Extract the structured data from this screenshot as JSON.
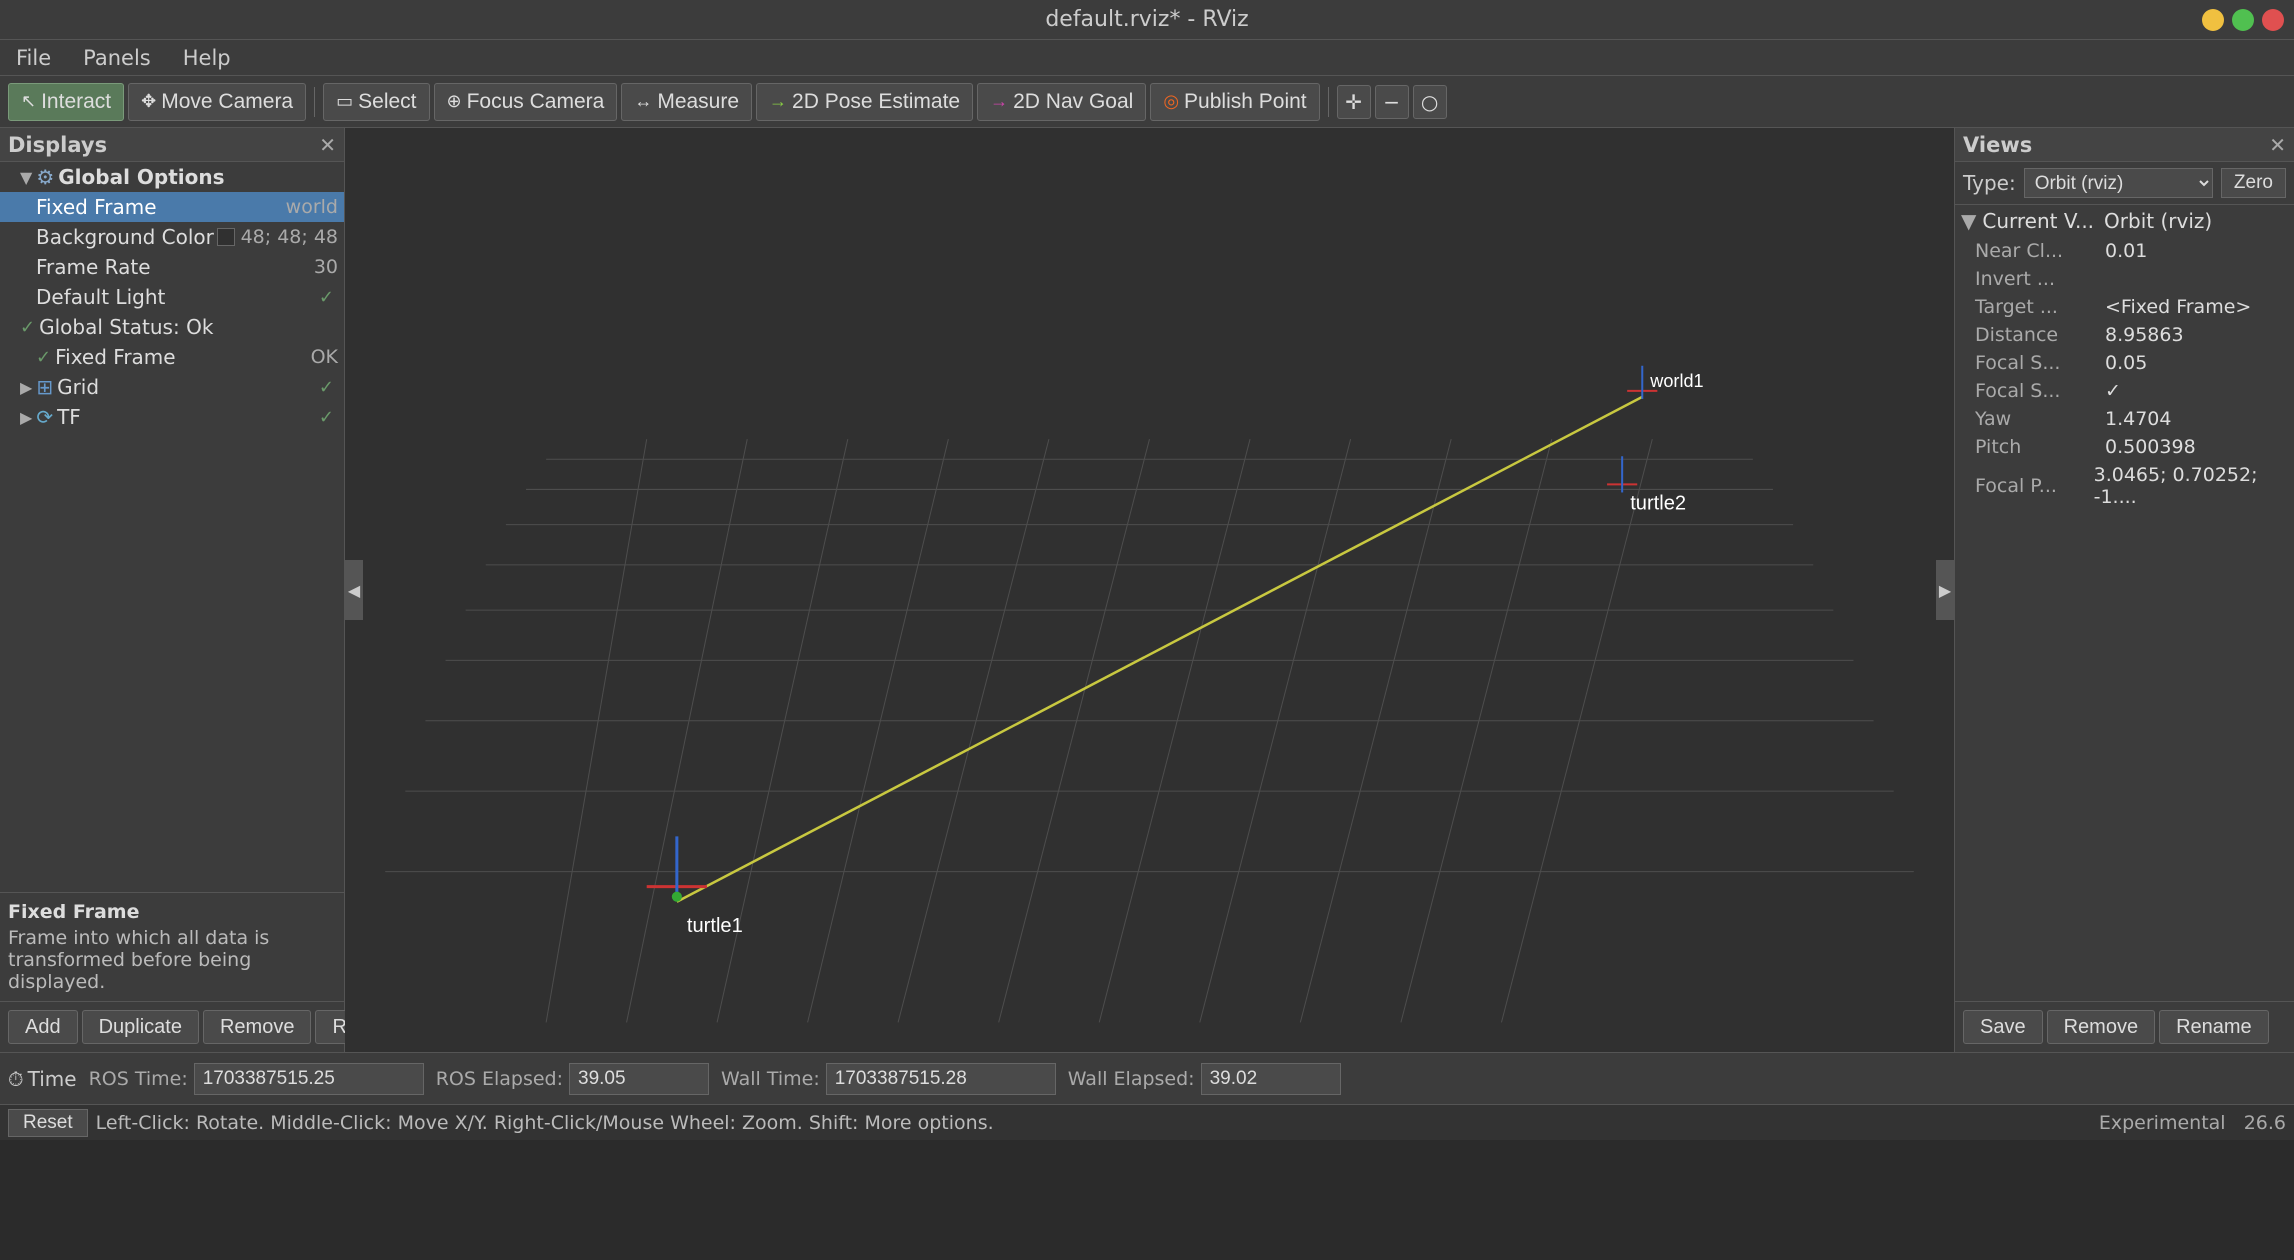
{
  "titlebar": {
    "title": "default.rviz* - RViz"
  },
  "menubar": {
    "items": [
      "File",
      "Panels",
      "Help"
    ]
  },
  "toolbar": {
    "interact_label": "Interact",
    "move_camera_label": "Move Camera",
    "select_label": "Select",
    "focus_camera_label": "Focus Camera",
    "measure_label": "Measure",
    "pose_estimate_label": "2D Pose Estimate",
    "nav_goal_label": "2D Nav Goal",
    "publish_point_label": "Publish Point"
  },
  "displays": {
    "title": "Displays",
    "global_options_label": "Global Options",
    "fixed_frame_label": "Fixed Frame",
    "fixed_frame_value": "world",
    "background_color_label": "Background Color",
    "background_color_value": "48; 48; 48",
    "frame_rate_label": "Frame Rate",
    "frame_rate_value": "30",
    "default_light_label": "Default Light",
    "default_light_value": "✓",
    "global_status_label": "Global Status: Ok",
    "global_status_fixed_label": "Fixed Frame",
    "global_status_fixed_value": "OK",
    "grid_label": "Grid",
    "tf_label": "TF",
    "info_title": "Fixed Frame",
    "info_text": "Frame into which all data is transformed before being displayed.",
    "add_btn": "Add",
    "duplicate_btn": "Duplicate",
    "remove_btn": "Remove",
    "rename_btn": "Rename"
  },
  "views": {
    "title": "Views",
    "type_label": "Type:",
    "type_value": "Orbit (rviz)",
    "zero_btn": "Zero",
    "current_v_label": "Current V...",
    "current_v_value": "Orbit (rviz)",
    "items": [
      {
        "label": "Near Cl...",
        "value": "0.01"
      },
      {
        "label": "Invert ...",
        "value": ""
      },
      {
        "label": "Target ...",
        "value": "<Fixed Frame>"
      },
      {
        "label": "Distance",
        "value": "8.95863"
      },
      {
        "label": "Focal S...",
        "value": "0.05"
      },
      {
        "label": "Focal S...",
        "value": "✓"
      },
      {
        "label": "Yaw",
        "value": "1.4704"
      },
      {
        "label": "Pitch",
        "value": "0.500398"
      },
      {
        "label": "Focal P...",
        "value": "3.0465; 0.70252; -1...."
      }
    ],
    "save_btn": "Save",
    "remove_btn": "Remove",
    "rename_btn": "Rename"
  },
  "time": {
    "toggle_label": "Time",
    "ros_time_label": "ROS Time:",
    "ros_time_value": "1703387515.25",
    "ros_elapsed_label": "ROS Elapsed:",
    "ros_elapsed_value": "39.05",
    "wall_time_label": "Wall Time:",
    "wall_time_value": "1703387515.28",
    "wall_elapsed_label": "Wall Elapsed:",
    "wall_elapsed_value": "39.02"
  },
  "statusbar": {
    "reset_btn": "Reset",
    "status_text": "Left-Click: Rotate.  Middle-Click: Move X/Y.  Right-Click/Mouse Wheel: Zoom.  Shift: More options.",
    "fps_label": "Experimental",
    "fps_value": "26.6"
  },
  "viewport": {
    "turtle1_label": "turtle1",
    "turtle2_label": "turtle2",
    "world1_label": "world1"
  }
}
